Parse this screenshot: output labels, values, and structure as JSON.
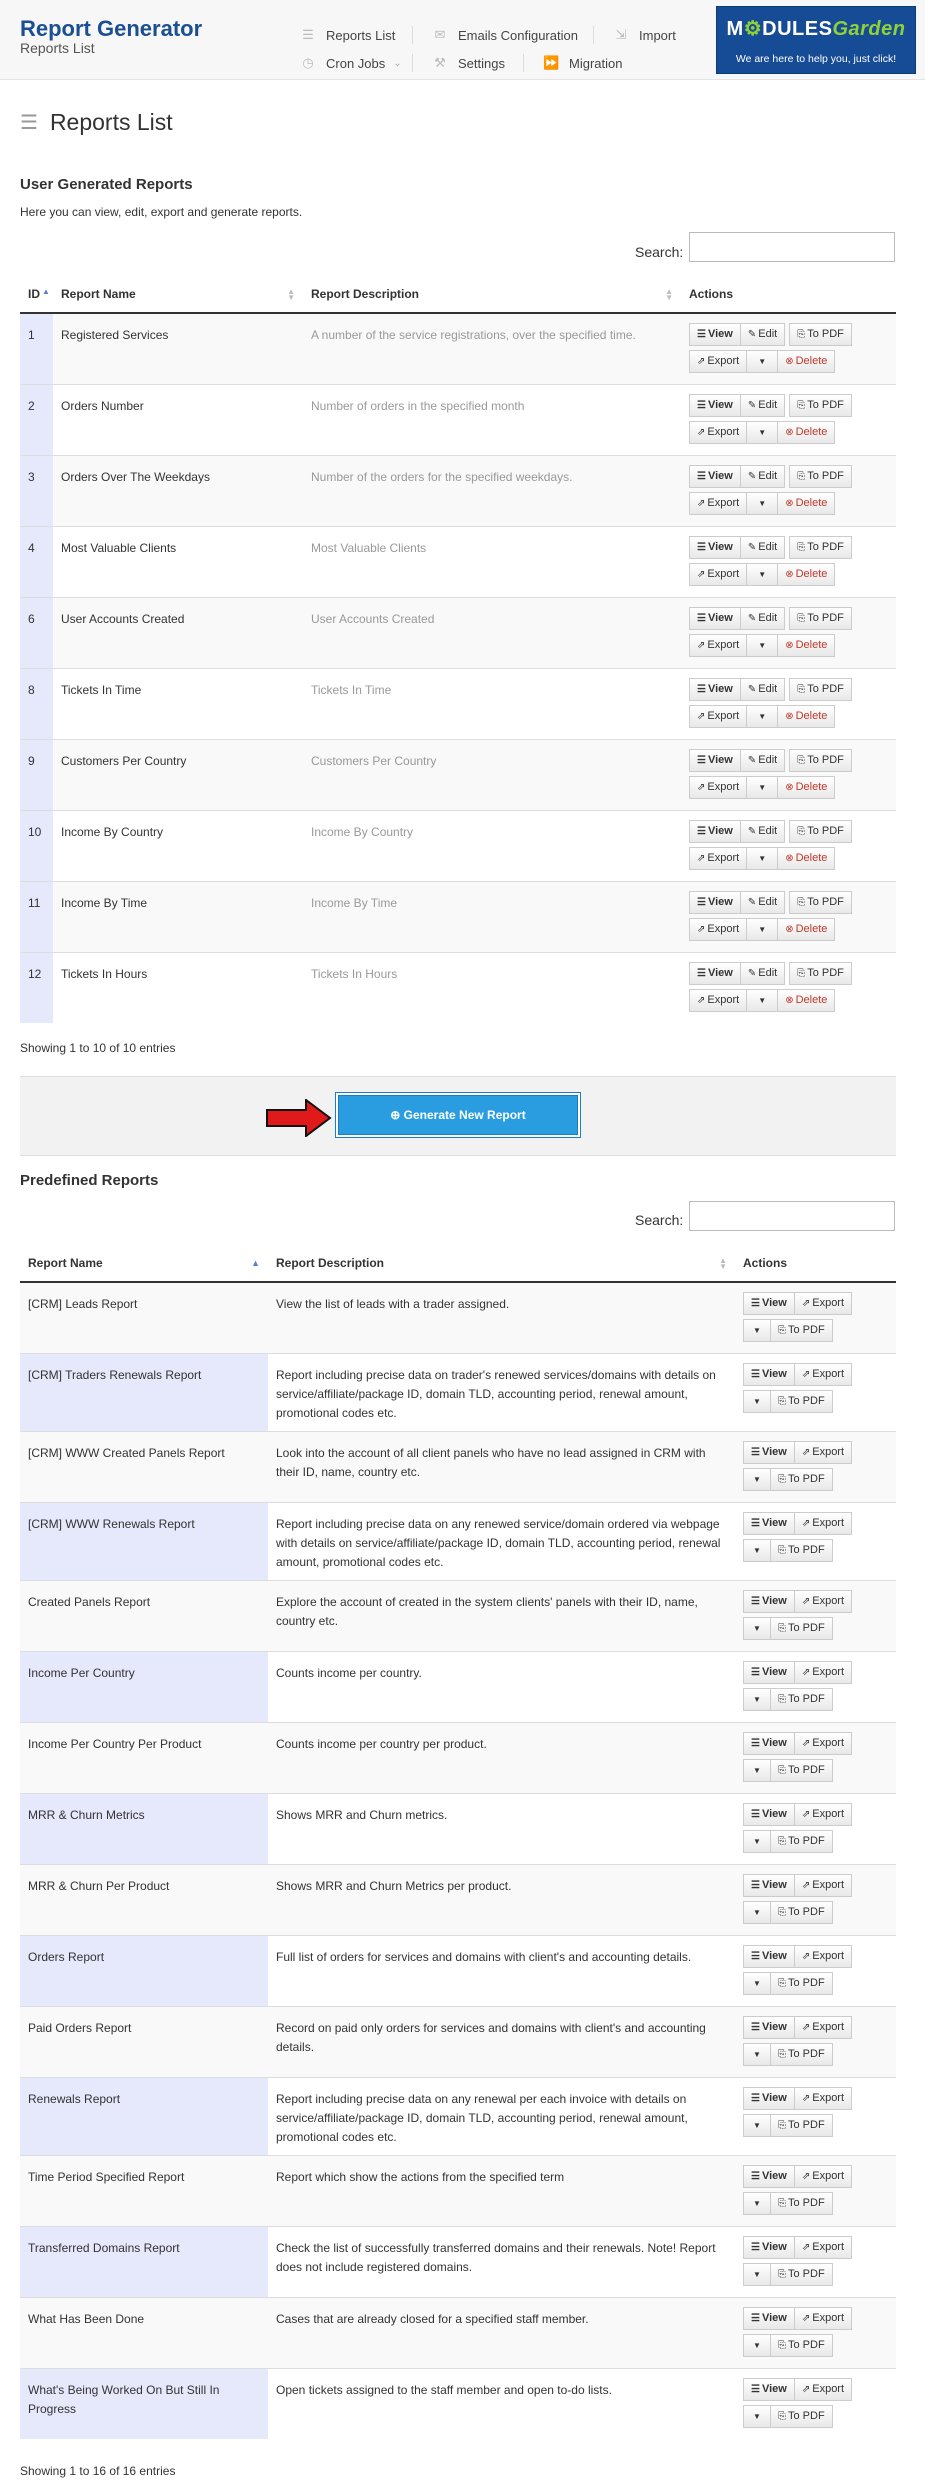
{
  "header": {
    "app_title": "Report Generator",
    "app_subtitle": "Reports List",
    "nav": {
      "reports_list": "Reports List",
      "emails_configuration": "Emails Configuration",
      "import": "Import",
      "cron_jobs": "Cron Jobs",
      "settings": "Settings",
      "migration": "Migration"
    },
    "logo": {
      "main_a": "M",
      "main_b": "DULES",
      "main_c": "Garden",
      "tagline": "We are here to help you, just click!"
    }
  },
  "page": {
    "title": "Reports List"
  },
  "user_reports": {
    "section_title": "User Generated Reports",
    "section_desc": "Here you can view, edit, export and generate reports.",
    "search_label": "Search:",
    "columns": {
      "id": "ID",
      "name": "Report Name",
      "description": "Report Description",
      "actions": "Actions"
    },
    "rows": [
      {
        "id": "1",
        "name": "Registered Services",
        "description": "A number of the service registrations, over the specified time."
      },
      {
        "id": "2",
        "name": "Orders Number",
        "description": "Number of orders in the specified month"
      },
      {
        "id": "3",
        "name": "Orders Over The Weekdays",
        "description": "Number of the orders for the specified weekdays."
      },
      {
        "id": "4",
        "name": "Most Valuable Clients",
        "description": "Most Valuable Clients"
      },
      {
        "id": "6",
        "name": "User Accounts Created",
        "description": "User Accounts Created"
      },
      {
        "id": "8",
        "name": "Tickets In Time",
        "description": "Tickets In Time"
      },
      {
        "id": "9",
        "name": "Customers Per Country",
        "description": "Customers Per Country"
      },
      {
        "id": "10",
        "name": "Income By Country",
        "description": "Income By Country"
      },
      {
        "id": "11",
        "name": "Income By Time",
        "description": "Income By Time"
      },
      {
        "id": "12",
        "name": "Tickets In Hours",
        "description": "Tickets In Hours"
      }
    ],
    "buttons": {
      "view": "View",
      "edit": "Edit",
      "to_pdf": "To PDF",
      "export": "Export",
      "delete": "Delete"
    },
    "showing": "Showing 1 to 10 of 10 entries",
    "generate_button": "Generate New Report"
  },
  "predefined_reports": {
    "section_title": "Predefined Reports",
    "search_label": "Search:",
    "columns": {
      "name": "Report Name",
      "description": "Report Description",
      "actions": "Actions"
    },
    "rows": [
      {
        "name": "[CRM] Leads Report",
        "description": "View the list of leads with a trader assigned."
      },
      {
        "name": "[CRM] Traders Renewals Report",
        "description": "Report including precise data on trader's renewed services/domains with details on service/affiliate/package ID, domain TLD, accounting period, renewal amount, promotional codes etc."
      },
      {
        "name": "[CRM] WWW Created Panels Report",
        "description": "Look into the account of all client panels who have no lead assigned in CRM with their ID, name, country etc."
      },
      {
        "name": "[CRM] WWW Renewals Report",
        "description": "Report including precise data on any renewed service/domain ordered via webpage with details on service/affiliate/package ID, domain TLD, accounting period, renewal amount, promotional codes etc."
      },
      {
        "name": "Created Panels Report",
        "description": "Explore the account of created in the system clients' panels with their ID, name, country etc."
      },
      {
        "name": "Income Per Country",
        "description": "Counts income per country."
      },
      {
        "name": "Income Per Country Per Product",
        "description": "Counts income per country per product."
      },
      {
        "name": "MRR & Churn Metrics",
        "description": "Shows MRR and Churn metrics."
      },
      {
        "name": "MRR & Churn Per Product",
        "description": "Shows MRR and Churn Metrics per product."
      },
      {
        "name": "Orders Report",
        "description": "Full list of orders for services and domains with client's and accounting details."
      },
      {
        "name": "Paid Orders Report",
        "description": "Record on paid only orders for services and domains with client's and accounting details."
      },
      {
        "name": "Renewals Report",
        "description": "Report including precise data on any renewal per each invoice with details on service/affiliate/package ID, domain TLD, accounting period, renewal amount, promotional codes etc."
      },
      {
        "name": "Time Period Specified Report",
        "description": "Report which show the actions from the specified term"
      },
      {
        "name": "Transferred Domains Report",
        "description": "Check the list of successfully transferred domains and their renewals. Note! Report does not include registered domains."
      },
      {
        "name": "What Has Been Done",
        "description": "Cases that are already closed for a specified staff member."
      },
      {
        "name": "What's Being Worked On But Still In Progress",
        "description": "Open tickets assigned to the staff member and open to-do lists."
      }
    ],
    "buttons": {
      "view": "View",
      "export": "Export",
      "to_pdf": "To PDF"
    },
    "showing": "Showing 1 to 16 of 16 entries"
  },
  "colors": {
    "brand_blue": "#1a5091",
    "generate_button": "#2a9de0",
    "delete_red": "#c0392b",
    "highlight_column": "#e6e8fb",
    "arrow_red": "#e01a1a"
  }
}
